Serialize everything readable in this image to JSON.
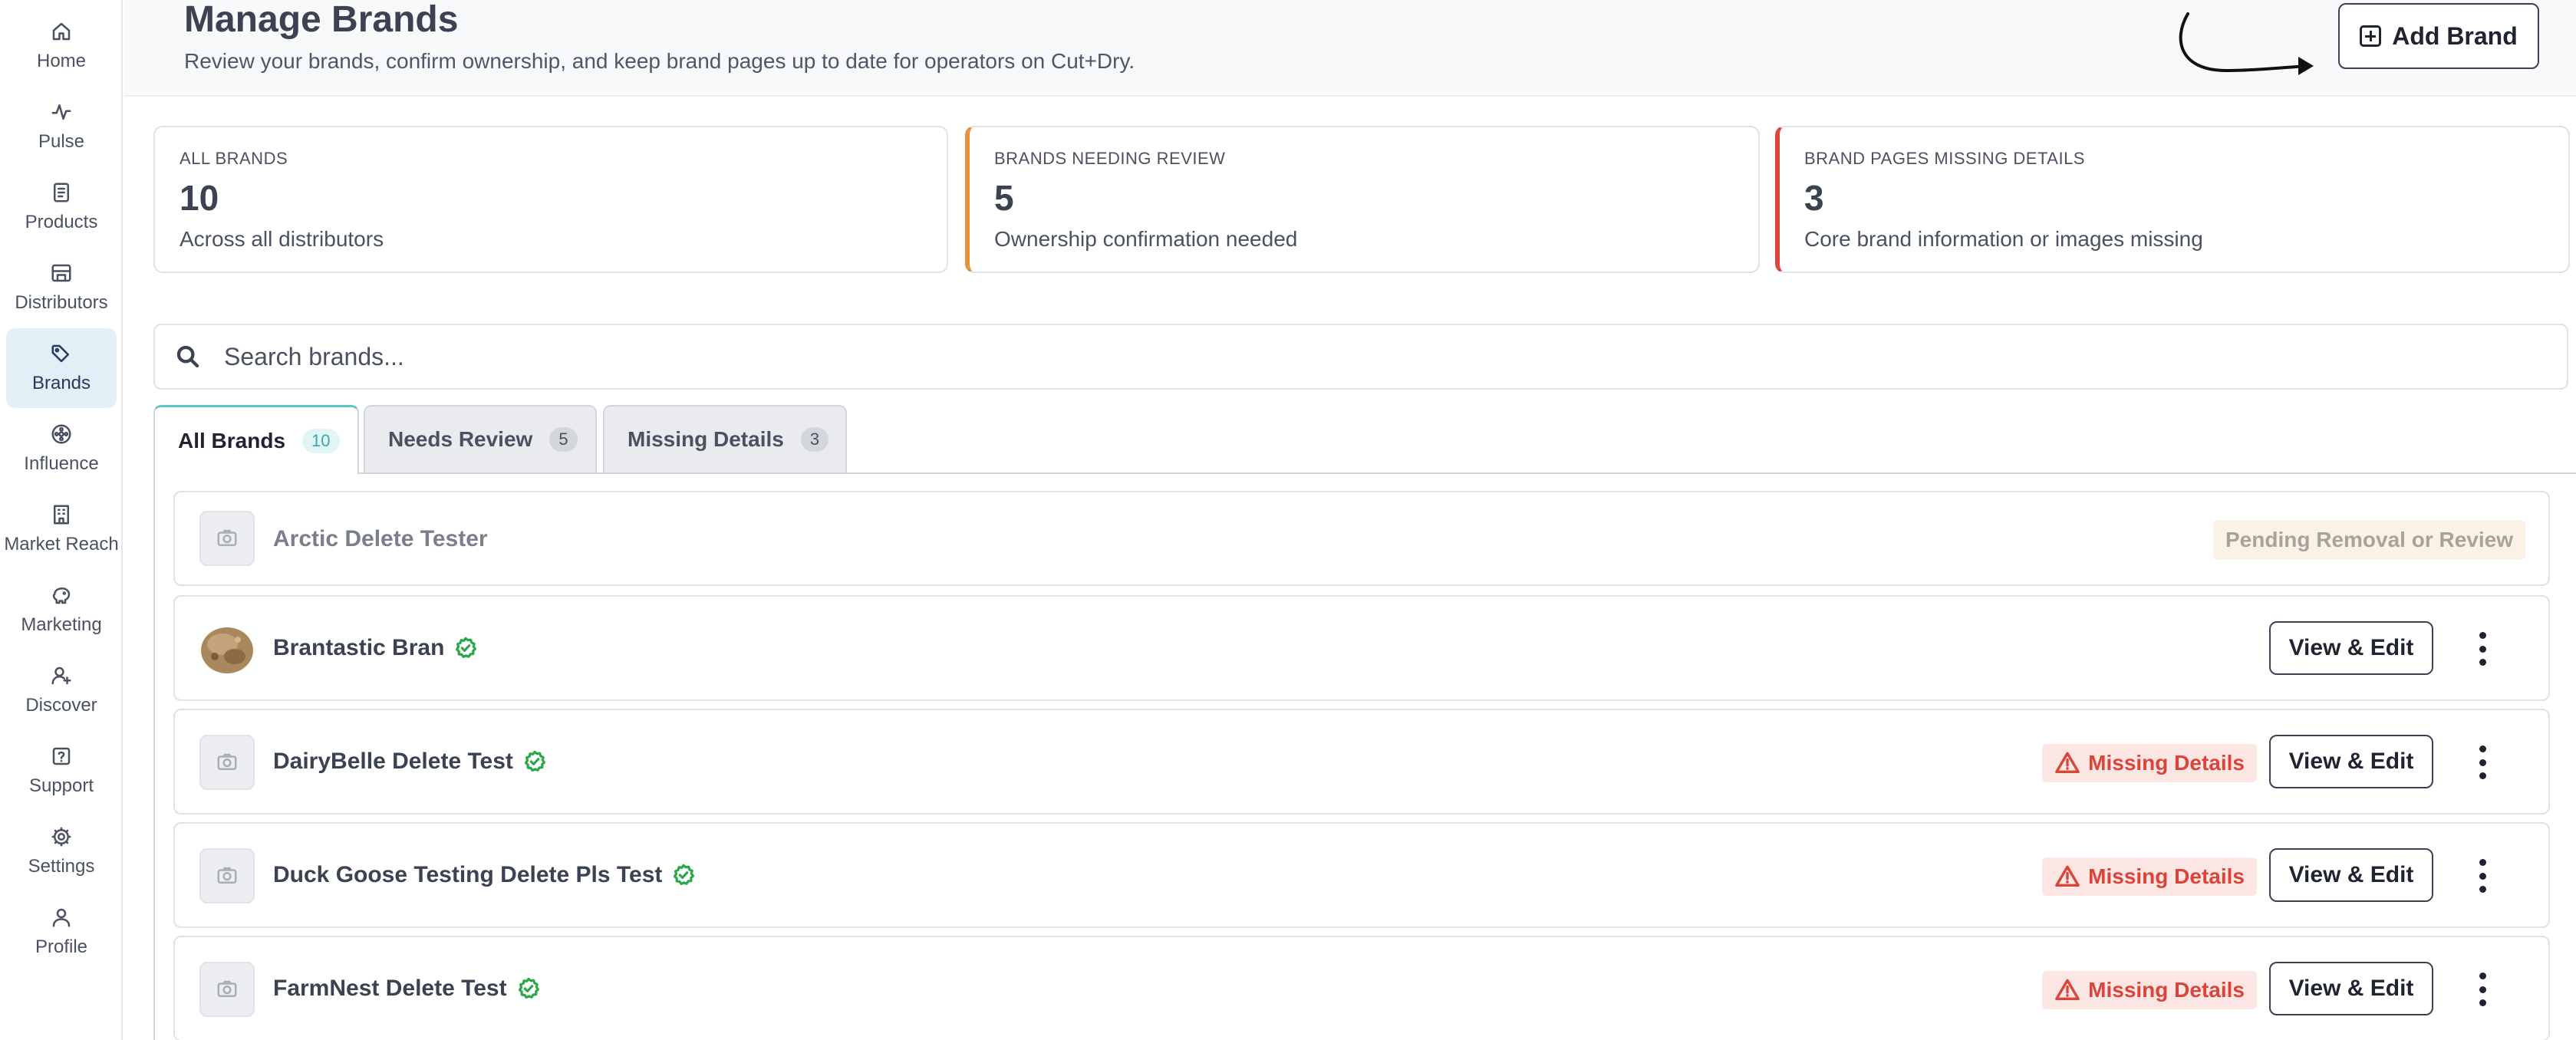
{
  "sidebar": {
    "items": [
      {
        "label": "Home",
        "icon": "home-icon"
      },
      {
        "label": "Pulse",
        "icon": "pulse-icon"
      },
      {
        "label": "Products",
        "icon": "products-icon"
      },
      {
        "label": "Distributors",
        "icon": "distributors-icon"
      },
      {
        "label": "Brands",
        "icon": "tag-icon",
        "active": true
      },
      {
        "label": "Influence",
        "icon": "influence-icon"
      },
      {
        "label": "Market Reach",
        "icon": "building-icon"
      },
      {
        "label": "Marketing",
        "icon": "piggy-bank-icon"
      },
      {
        "label": "Discover",
        "icon": "user-plus-icon"
      },
      {
        "label": "Support",
        "icon": "question-icon"
      },
      {
        "label": "Settings",
        "icon": "gear-icon"
      },
      {
        "label": "Profile",
        "icon": "user-icon"
      }
    ]
  },
  "header": {
    "title": "Manage Brands",
    "subtitle": "Review your brands, confirm ownership, and keep brand pages up to date for operators on Cut+Dry.",
    "add_button_label": "Add Brand"
  },
  "stats": [
    {
      "label": "ALL BRANDS",
      "value": "10",
      "desc": "Across all distributors"
    },
    {
      "label": "BRANDS NEEDING REVIEW",
      "value": "5",
      "desc": "Ownership confirmation needed",
      "accent": "#e8913c"
    },
    {
      "label": "BRAND PAGES MISSING DETAILS",
      "value": "3",
      "desc": "Core brand information or images missing",
      "accent": "#d94a3d"
    }
  ],
  "search": {
    "placeholder": "Search brands...",
    "value": ""
  },
  "tabs": [
    {
      "label": "All Brands",
      "count": "10",
      "active": true
    },
    {
      "label": "Needs Review",
      "count": "5"
    },
    {
      "label": "Missing Details",
      "count": "3"
    }
  ],
  "brands": [
    {
      "name": "Arctic Delete Tester",
      "status": "Pending Removal or Review"
    },
    {
      "name": "Brantastic Bran",
      "verified": true
    },
    {
      "name": "DairyBelle Delete Test",
      "verified": true,
      "badge": "Missing Details"
    },
    {
      "name": "Duck Goose Testing Delete Pls Test",
      "verified": true,
      "badge": "Missing Details"
    },
    {
      "name": "FarmNest Delete Test",
      "verified": true,
      "badge": "Missing Details"
    }
  ],
  "row_actions": {
    "view_edit_label": "View & Edit"
  },
  "colors": {
    "accent_teal": "#5fc4c2",
    "review_orange": "#e8913c",
    "missing_red": "#d94a3d",
    "verified_green": "#2aa84a"
  }
}
